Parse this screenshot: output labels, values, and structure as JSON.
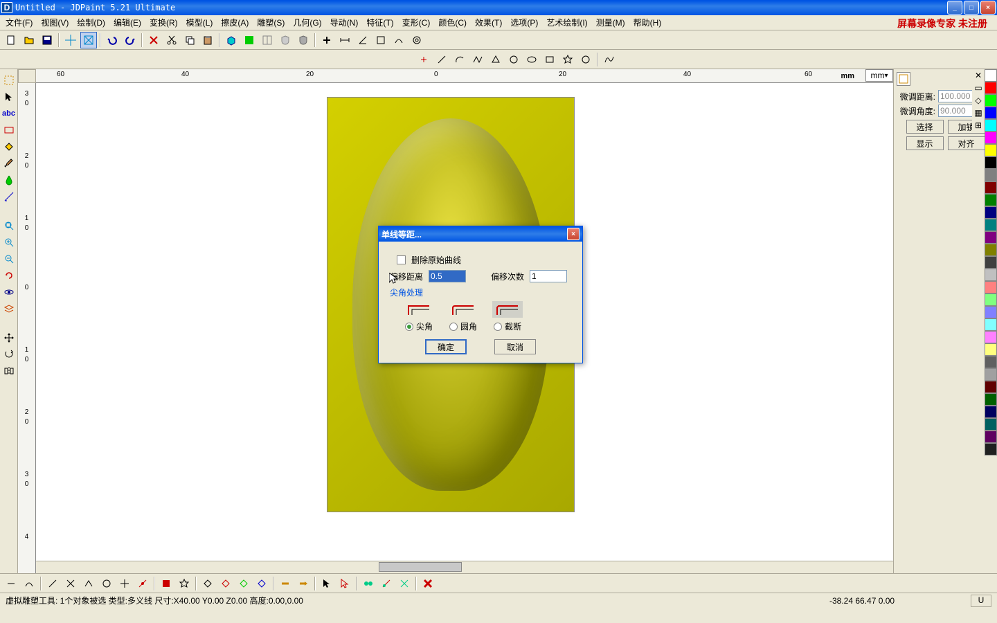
{
  "titlebar": {
    "icon": "D",
    "text": "Untitled - JDPaint 5.21 Ultimate"
  },
  "window_buttons": {
    "min": "_",
    "max": "□",
    "close": "×"
  },
  "watermark": "屏幕录像专家 未注册",
  "menus": [
    "文件(F)",
    "视图(V)",
    "绘制(D)",
    "编辑(E)",
    "变换(R)",
    "模型(L)",
    "擦皮(A)",
    "雕塑(S)",
    "几何(G)",
    "导动(N)",
    "特征(T)",
    "变形(C)",
    "颜色(C)",
    "效果(T)",
    "选项(P)",
    "艺术绘制(I)",
    "测量(M)",
    "帮助(H)"
  ],
  "ruler": {
    "ticks": [
      "60",
      "40",
      "20",
      "0",
      "20",
      "40",
      "60"
    ],
    "unit": "mm",
    "vticks": [
      "3",
      "0",
      "2",
      "0",
      "1",
      "0",
      "0",
      "1",
      "0",
      "2",
      "0",
      "3",
      "0",
      "4"
    ]
  },
  "right_panel": {
    "dist_label": "微调距离:",
    "dist_val": "100.000",
    "angle_label": "微调角度:",
    "angle_val": "90.000",
    "btn_select": "选择",
    "btn_lock": "加锁",
    "btn_show": "显示",
    "btn_align": "对齐"
  },
  "colors": [
    "#ffffff",
    "#ff0000",
    "#00ff00",
    "#0000ff",
    "#00ffff",
    "#ff00ff",
    "#ffff00",
    "#000000",
    "#808080",
    "#800000",
    "#008000",
    "#000080",
    "#008080",
    "#800080",
    "#808000",
    "#404040",
    "#c0c0c0",
    "#ff8080",
    "#80ff80",
    "#8080ff",
    "#80ffff",
    "#ff80ff",
    "#ffff80",
    "#606060",
    "#a0a0a0",
    "#600000",
    "#006000",
    "#000060",
    "#006060",
    "#600060",
    "#202020"
  ],
  "dialog": {
    "title": "单线等距...",
    "chk_delete": "删除原始曲线",
    "offset_dist_label": "偏移距离",
    "offset_dist_val": "0.5",
    "offset_count_label": "偏移次数",
    "offset_count_val": "1",
    "corner_title": "尖角处理",
    "corner_sharp": "尖角",
    "corner_round": "圆角",
    "corner_cut": "截断",
    "ok": "确定",
    "cancel": "取消"
  },
  "statusbar": {
    "left": "虚拟雕塑工具: 1个对象被选 类型:多义线  尺寸:X40.00 Y0.00 Z0.00 高度:0.00,0.00",
    "coords": "-38.24 66.47 0.00",
    "box": "U"
  },
  "mm_dropdown": "mm"
}
